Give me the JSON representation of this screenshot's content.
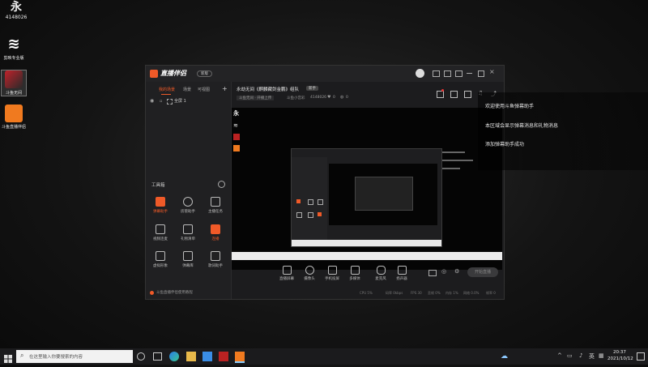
{
  "desktop": {
    "topleft_id": "4148026",
    "icons": [
      {
        "label": "剪映专业版"
      },
      {
        "label": "斗鱼无间"
      },
      {
        "label": "斗鱼直播伴侣"
      }
    ]
  },
  "app": {
    "brand": "直播伴侣",
    "version_badge": "新版",
    "stream_title": "永劫无间《麒麟藏剑金鹏》组队",
    "title_tag": "新手",
    "subtitle": "斗鱼无间 · 开播上传",
    "room_label": "斗鱼小宫彩",
    "room_id": "4148026",
    "stat_likes": "0",
    "stat_viewers": "0",
    "sidebar": {
      "tabs": [
        "我的场景",
        "场景",
        "可视图"
      ],
      "scene_item": "全屏 1",
      "toolbox_title": "工具箱",
      "tools": [
        "弹幕助手",
        "房管助手",
        "主播任务",
        "视频连麦",
        "礼物清单",
        "连播",
        "虚拟形象",
        "弹幕库",
        "歌词助手"
      ],
      "footer_text": "斗鱼直播伴侣使用教程"
    },
    "controls": [
      "直播屏幕",
      "摄像头",
      "手机投屏",
      "多媒体",
      "麦克风",
      "扬声器"
    ],
    "start_button": "开始直播",
    "status": {
      "cpu": "CPU 5%",
      "rate": "码率 0kbps",
      "fps": "FPS 30",
      "delay": "丢帧 0%",
      "mem": "内存 1%",
      "net": "网络 0.0%",
      "extra": "帧率 0"
    }
  },
  "danmaku": {
    "messages": [
      "欢迎使用斗鱼弹幕助手",
      "本区域会显示弹幕消息和礼物消息",
      "添加弹幕助手成功"
    ]
  },
  "taskbar": {
    "search_placeholder": "在这里输入你要搜索的内容",
    "time": "20:37",
    "date": "2021/10/12"
  }
}
